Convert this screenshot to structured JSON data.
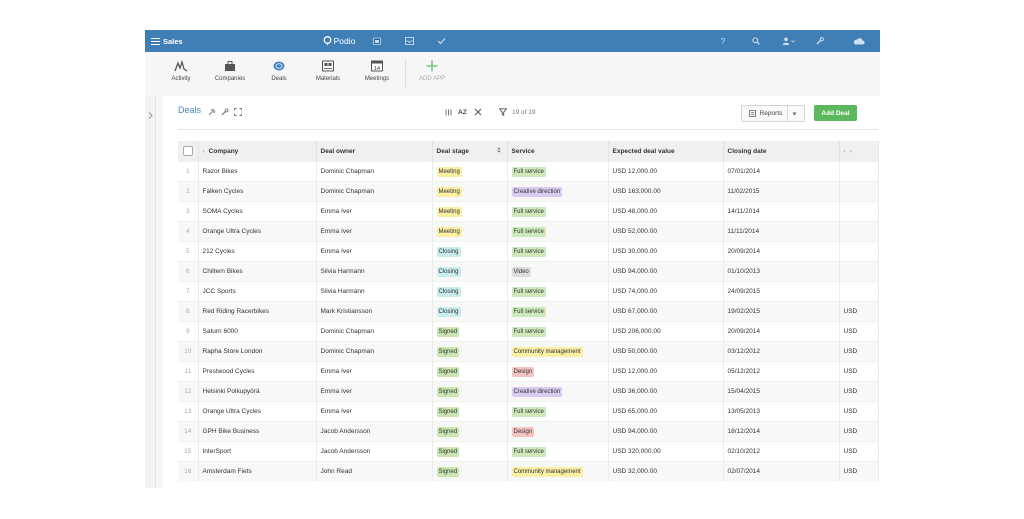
{
  "topbar": {
    "workspace": "Sales",
    "brand": "Podio",
    "help_glyph": "?",
    "icons": [
      "calendar-icon",
      "inbox-icon",
      "check-icon",
      "help-icon",
      "search-icon",
      "user-icon",
      "tools-icon",
      "cloud-icon"
    ]
  },
  "apps": [
    {
      "label": "Activity",
      "icon": "activity-icon"
    },
    {
      "label": "Companies",
      "icon": "companies-icon"
    },
    {
      "label": "Deals",
      "icon": "deals-icon"
    },
    {
      "label": "Materials",
      "icon": "materials-icon"
    },
    {
      "label": "Meetings",
      "icon": "meetings-icon"
    },
    {
      "label": "ADD APP",
      "icon": "plus-icon"
    }
  ],
  "meetings_day": "14",
  "header": {
    "title": "Deals",
    "sort_label": "AZ",
    "filter_count": "19 of 19",
    "reports_label": "Reports",
    "add_label": "Add Deal"
  },
  "colors": {
    "topbar": "#3f7fb5",
    "add_button": "#5cb85c",
    "meeting": "#fbeea5",
    "closing": "#c9ecec",
    "signed": "#cbe6b3",
    "full_service": "#cde9bb",
    "creative": "#d7cdf2",
    "video": "#dddddd",
    "community": "#fbeea5",
    "design": "#f6c3c3"
  },
  "columns": [
    "Company",
    "Deal owner",
    "Deal stage",
    "Service",
    "Expected deal value",
    "Closing date"
  ],
  "rows": [
    {
      "num": "1",
      "company": "Razor Bikes",
      "owner": "Dominic Chapman",
      "stage": "Meeting",
      "service": "Full service",
      "value": "USD 12,000.00",
      "date": "07/01/2014",
      "extra": ""
    },
    {
      "num": "2",
      "company": "Falken Cycles",
      "owner": "Dominic Chapman",
      "stage": "Meeting",
      "service": "Creative direction",
      "value": "USD 163,000.00",
      "date": "11/02/2015",
      "extra": ""
    },
    {
      "num": "3",
      "company": "SOMA Cycles",
      "owner": "Emma Iver",
      "stage": "Meeting",
      "service": "Full service",
      "value": "USD 48,000.00",
      "date": "14/11/2014",
      "extra": ""
    },
    {
      "num": "4",
      "company": "Orange Ultra Cycles",
      "owner": "Emma Iver",
      "stage": "Meeting",
      "service": "Full service",
      "value": "USD 52,000.00",
      "date": "11/11/2014",
      "extra": ""
    },
    {
      "num": "5",
      "company": "212 Cycles",
      "owner": "Emma Iver",
      "stage": "Closing",
      "service": "Full service",
      "value": "USD 30,000.00",
      "date": "20/09/2014",
      "extra": ""
    },
    {
      "num": "6",
      "company": "Chiltern Bikes",
      "owner": "Silvia Harmann",
      "stage": "Closing",
      "service": "Video",
      "value": "USD 94,000.00",
      "date": "01/10/2013",
      "extra": ""
    },
    {
      "num": "7",
      "company": "JCC Sports",
      "owner": "Silvia Harmann",
      "stage": "Closing",
      "service": "Full service",
      "value": "USD 74,000.00",
      "date": "24/09/2015",
      "extra": ""
    },
    {
      "num": "8",
      "company": "Red Riding Racerbikes",
      "owner": "Mark Kristiansson",
      "stage": "Closing",
      "service": "Full service",
      "value": "USD 67,000.00",
      "date": "19/02/2015",
      "extra": "USD"
    },
    {
      "num": "9",
      "company": "Saturn 6000",
      "owner": "Dominic Chapman",
      "stage": "Signed",
      "service": "Full service",
      "value": "USD 206,000.00",
      "date": "20/09/2014",
      "extra": "USD"
    },
    {
      "num": "10",
      "company": "Rapha Store London",
      "owner": "Dominic Chapman",
      "stage": "Signed",
      "service": "Community management",
      "value": "USD 50,000.00",
      "date": "03/12/2012",
      "extra": "USD"
    },
    {
      "num": "11",
      "company": "Prestwood Cycles",
      "owner": "Emma Iver",
      "stage": "Signed",
      "service": "Design",
      "value": "USD 12,000.00",
      "date": "05/12/2012",
      "extra": "USD"
    },
    {
      "num": "12",
      "company": "Helsinki Polkupyörä",
      "owner": "Emma Iver",
      "stage": "Signed",
      "service": "Creative direction",
      "value": "USD 36,000.00",
      "date": "15/04/2015",
      "extra": "USD"
    },
    {
      "num": "13",
      "company": "Orange Ultra Cycles",
      "owner": "Emma Iver",
      "stage": "Signed",
      "service": "Full service",
      "value": "USD 65,000.00",
      "date": "13/05/2013",
      "extra": "USD"
    },
    {
      "num": "14",
      "company": "GPH Bike Business",
      "owner": "Jacob Andersson",
      "stage": "Signed",
      "service": "Design",
      "value": "USD 94,000.00",
      "date": "18/12/2014",
      "extra": "USD"
    },
    {
      "num": "15",
      "company": "InterSport",
      "owner": "Jacob Andersson",
      "stage": "Signed",
      "service": "Full service",
      "value": "USD 320,000.00",
      "date": "02/10/2012",
      "extra": "USD"
    },
    {
      "num": "16",
      "company": "Amsterdam Fiets",
      "owner": "John Read",
      "stage": "Signed",
      "service": "Community management",
      "value": "USD 32,000.00",
      "date": "02/07/2014",
      "extra": "USD"
    }
  ]
}
